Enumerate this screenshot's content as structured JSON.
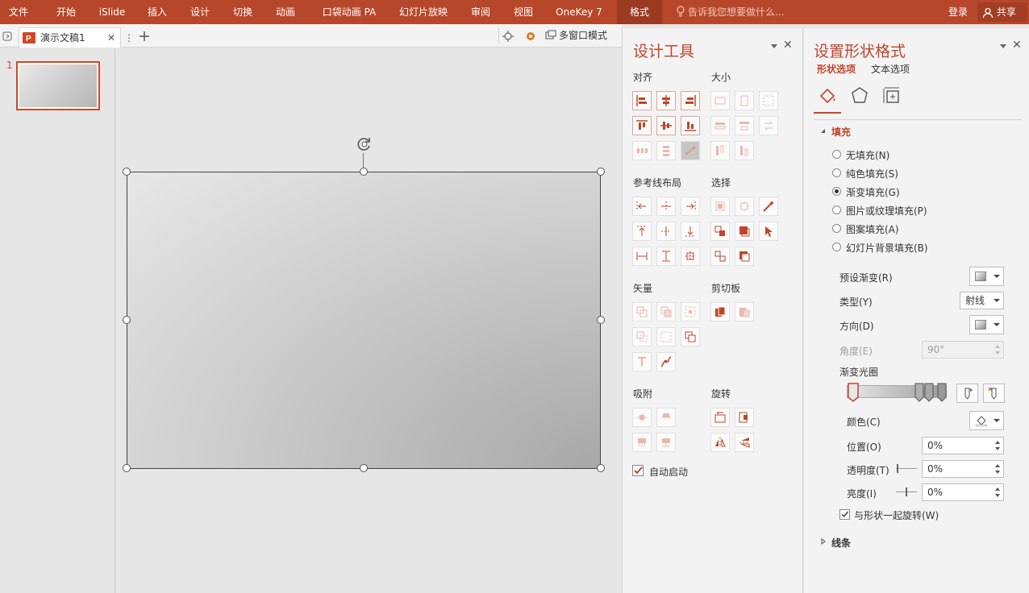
{
  "ribbon": {
    "tabs": [
      "文件",
      "开始",
      "iSlide",
      "插入",
      "设计",
      "切换",
      "动画",
      "口袋动画 PA",
      "幻灯片放映",
      "审阅",
      "视图",
      "OneKey 7",
      "格式"
    ],
    "tell_me": "告诉我您想要做什么...",
    "login": "登录",
    "share": "共享",
    "brand_color": "#b7472a"
  },
  "document": {
    "tab_name": "演示文稿1",
    "multi_window": "多窗口模式",
    "slide_number": "1"
  },
  "design_tools": {
    "title": "设计工具",
    "sections": {
      "align": "对齐",
      "size": "大小",
      "guides": "参考线布局",
      "select": "选择",
      "vector": "矢量",
      "clipboard": "剪切板",
      "snap": "吸附",
      "rotate": "旋转"
    },
    "auto_start": "自动启动"
  },
  "format_pane": {
    "title": "设置形状格式",
    "tabs": {
      "shape": "形状选项",
      "text": "文本选项"
    },
    "fill_section": "填充",
    "fill_options": [
      "无填充(N)",
      "纯色填充(S)",
      "渐变填充(G)",
      "图片或纹理填充(P)",
      "图案填充(A)",
      "幻灯片背景填充(B)"
    ],
    "selected_fill": "渐变填充(G)",
    "preset": "预设渐变(R)",
    "type_label": "类型(Y)",
    "type_value": "射线",
    "direction": "方向(D)",
    "angle_label": "角度(E)",
    "angle_value": "90°",
    "stops_label": "渐变光圈",
    "color_label": "颜色(C)",
    "position_label": "位置(O)",
    "position_value": "0%",
    "transparency_label": "透明度(T)",
    "transparency_value": "0%",
    "brightness_label": "亮度(I)",
    "brightness_value": "0%",
    "rotate_with_shape": "与形状一起旋转(W)",
    "line_section": "线条"
  }
}
